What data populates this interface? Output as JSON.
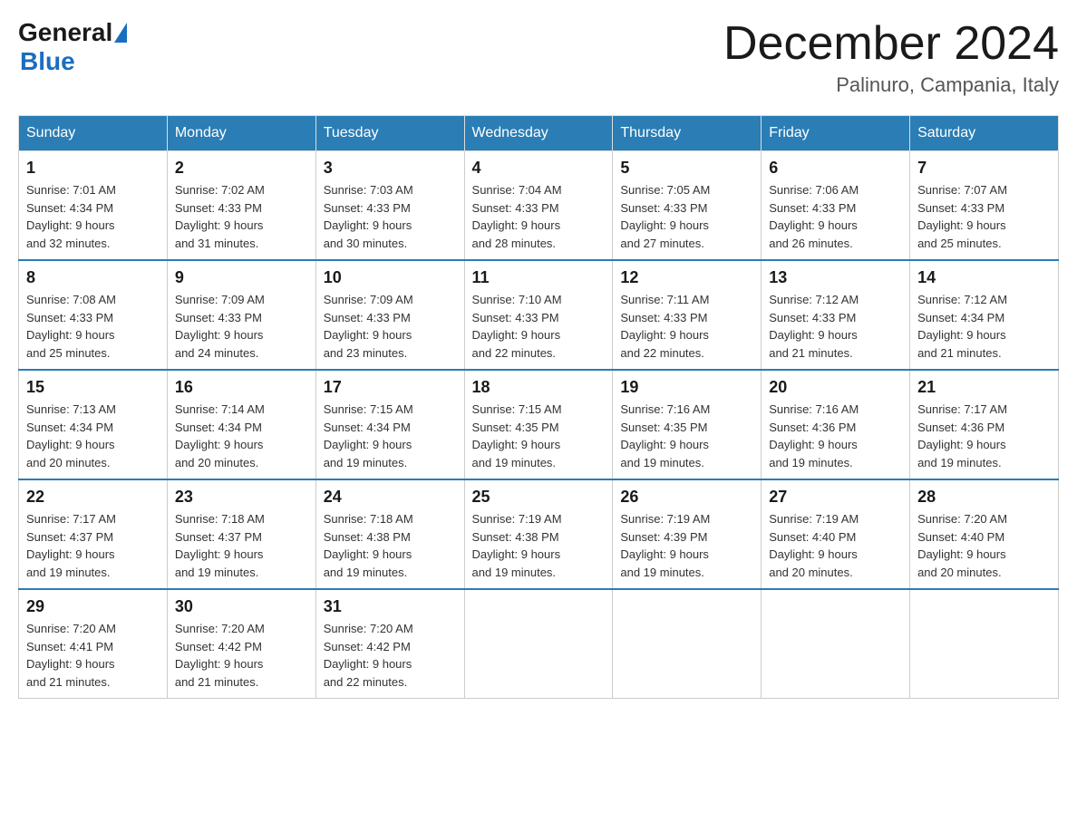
{
  "header": {
    "logo": {
      "general": "General",
      "blue": "Blue"
    },
    "title": "December 2024",
    "location": "Palinuro, Campania, Italy"
  },
  "weekdays": [
    "Sunday",
    "Monday",
    "Tuesday",
    "Wednesday",
    "Thursday",
    "Friday",
    "Saturday"
  ],
  "weeks": [
    [
      {
        "day": "1",
        "sunrise": "7:01 AM",
        "sunset": "4:34 PM",
        "daylight": "9 hours and 32 minutes."
      },
      {
        "day": "2",
        "sunrise": "7:02 AM",
        "sunset": "4:33 PM",
        "daylight": "9 hours and 31 minutes."
      },
      {
        "day": "3",
        "sunrise": "7:03 AM",
        "sunset": "4:33 PM",
        "daylight": "9 hours and 30 minutes."
      },
      {
        "day": "4",
        "sunrise": "7:04 AM",
        "sunset": "4:33 PM",
        "daylight": "9 hours and 28 minutes."
      },
      {
        "day": "5",
        "sunrise": "7:05 AM",
        "sunset": "4:33 PM",
        "daylight": "9 hours and 27 minutes."
      },
      {
        "day": "6",
        "sunrise": "7:06 AM",
        "sunset": "4:33 PM",
        "daylight": "9 hours and 26 minutes."
      },
      {
        "day": "7",
        "sunrise": "7:07 AM",
        "sunset": "4:33 PM",
        "daylight": "9 hours and 25 minutes."
      }
    ],
    [
      {
        "day": "8",
        "sunrise": "7:08 AM",
        "sunset": "4:33 PM",
        "daylight": "9 hours and 25 minutes."
      },
      {
        "day": "9",
        "sunrise": "7:09 AM",
        "sunset": "4:33 PM",
        "daylight": "9 hours and 24 minutes."
      },
      {
        "day": "10",
        "sunrise": "7:09 AM",
        "sunset": "4:33 PM",
        "daylight": "9 hours and 23 minutes."
      },
      {
        "day": "11",
        "sunrise": "7:10 AM",
        "sunset": "4:33 PM",
        "daylight": "9 hours and 22 minutes."
      },
      {
        "day": "12",
        "sunrise": "7:11 AM",
        "sunset": "4:33 PM",
        "daylight": "9 hours and 22 minutes."
      },
      {
        "day": "13",
        "sunrise": "7:12 AM",
        "sunset": "4:33 PM",
        "daylight": "9 hours and 21 minutes."
      },
      {
        "day": "14",
        "sunrise": "7:12 AM",
        "sunset": "4:34 PM",
        "daylight": "9 hours and 21 minutes."
      }
    ],
    [
      {
        "day": "15",
        "sunrise": "7:13 AM",
        "sunset": "4:34 PM",
        "daylight": "9 hours and 20 minutes."
      },
      {
        "day": "16",
        "sunrise": "7:14 AM",
        "sunset": "4:34 PM",
        "daylight": "9 hours and 20 minutes."
      },
      {
        "day": "17",
        "sunrise": "7:15 AM",
        "sunset": "4:34 PM",
        "daylight": "9 hours and 19 minutes."
      },
      {
        "day": "18",
        "sunrise": "7:15 AM",
        "sunset": "4:35 PM",
        "daylight": "9 hours and 19 minutes."
      },
      {
        "day": "19",
        "sunrise": "7:16 AM",
        "sunset": "4:35 PM",
        "daylight": "9 hours and 19 minutes."
      },
      {
        "day": "20",
        "sunrise": "7:16 AM",
        "sunset": "4:36 PM",
        "daylight": "9 hours and 19 minutes."
      },
      {
        "day": "21",
        "sunrise": "7:17 AM",
        "sunset": "4:36 PM",
        "daylight": "9 hours and 19 minutes."
      }
    ],
    [
      {
        "day": "22",
        "sunrise": "7:17 AM",
        "sunset": "4:37 PM",
        "daylight": "9 hours and 19 minutes."
      },
      {
        "day": "23",
        "sunrise": "7:18 AM",
        "sunset": "4:37 PM",
        "daylight": "9 hours and 19 minutes."
      },
      {
        "day": "24",
        "sunrise": "7:18 AM",
        "sunset": "4:38 PM",
        "daylight": "9 hours and 19 minutes."
      },
      {
        "day": "25",
        "sunrise": "7:19 AM",
        "sunset": "4:38 PM",
        "daylight": "9 hours and 19 minutes."
      },
      {
        "day": "26",
        "sunrise": "7:19 AM",
        "sunset": "4:39 PM",
        "daylight": "9 hours and 19 minutes."
      },
      {
        "day": "27",
        "sunrise": "7:19 AM",
        "sunset": "4:40 PM",
        "daylight": "9 hours and 20 minutes."
      },
      {
        "day": "28",
        "sunrise": "7:20 AM",
        "sunset": "4:40 PM",
        "daylight": "9 hours and 20 minutes."
      }
    ],
    [
      {
        "day": "29",
        "sunrise": "7:20 AM",
        "sunset": "4:41 PM",
        "daylight": "9 hours and 21 minutes."
      },
      {
        "day": "30",
        "sunrise": "7:20 AM",
        "sunset": "4:42 PM",
        "daylight": "9 hours and 21 minutes."
      },
      {
        "day": "31",
        "sunrise": "7:20 AM",
        "sunset": "4:42 PM",
        "daylight": "9 hours and 22 minutes."
      },
      null,
      null,
      null,
      null
    ]
  ],
  "labels": {
    "sunrise": "Sunrise:",
    "sunset": "Sunset:",
    "daylight": "Daylight:"
  }
}
